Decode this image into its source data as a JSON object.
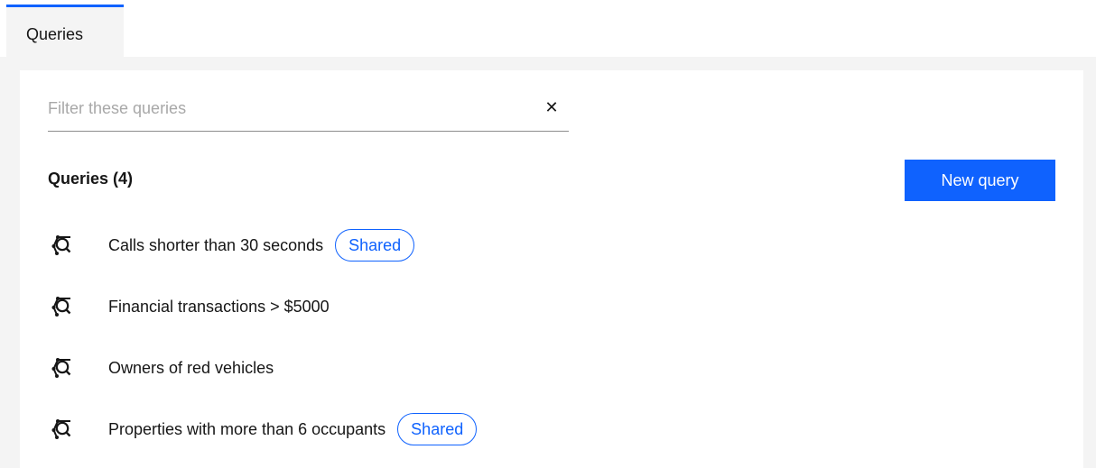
{
  "tabs": [
    {
      "label": "Queries",
      "active": true
    }
  ],
  "filter": {
    "placeholder": "Filter these queries",
    "value": "",
    "clear_icon": "close-icon"
  },
  "list": {
    "title": "Queries (4)",
    "new_button_label": "New query",
    "items": [
      {
        "name": "Calls shorter than 30 seconds",
        "tag": "Shared",
        "icon": "query-graph-icon"
      },
      {
        "name": "Financial transactions > $5000",
        "tag": "",
        "icon": "query-graph-icon"
      },
      {
        "name": "Owners of red vehicles",
        "tag": "",
        "icon": "query-graph-icon"
      },
      {
        "name": "Properties with more than 6 occupants",
        "tag": "Shared",
        "icon": "query-graph-icon"
      }
    ]
  },
  "colors": {
    "accent": "#0f62fe",
    "background": "#f4f4f4",
    "panel": "#ffffff",
    "text": "#161616",
    "placeholder": "#a8a8a8"
  }
}
